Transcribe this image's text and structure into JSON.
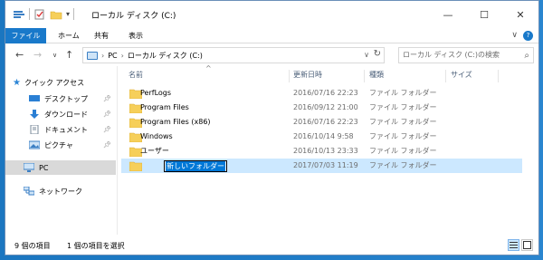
{
  "window": {
    "title": "ローカル ディスク (C:)",
    "controls": {
      "minimize": "—",
      "maximize": "☐",
      "close": "✕"
    }
  },
  "ribbon": {
    "tabs": [
      {
        "label": "ファイル",
        "active": true
      },
      {
        "label": "ホーム"
      },
      {
        "label": "共有"
      },
      {
        "label": "表示"
      }
    ],
    "expand": "∨",
    "help": "?"
  },
  "address_bar": {
    "segments": [
      "PC",
      "ローカル ディスク (C:)"
    ]
  },
  "search": {
    "placeholder": "ローカル ディスク (C:)の検索"
  },
  "navigation": {
    "quick_access": "クイック アクセス",
    "pinned": [
      {
        "label": "デスクトップ",
        "icon": "desktop-icon"
      },
      {
        "label": "ダウンロード",
        "icon": "download-icon"
      },
      {
        "label": "ドキュメント",
        "icon": "documents-icon"
      },
      {
        "label": "ピクチャ",
        "icon": "pictures-icon"
      }
    ],
    "pc": "PC",
    "network": "ネットワーク"
  },
  "columns": {
    "name": "名前",
    "modified": "更新日時",
    "type": "種類",
    "size": "サイズ"
  },
  "files": [
    {
      "name": "PerfLogs",
      "modified": "2016/07/16 22:23",
      "type": "ファイル フォルダー"
    },
    {
      "name": "Program Files",
      "modified": "2016/09/12 21:00",
      "type": "ファイル フォルダー"
    },
    {
      "name": "Program Files (x86)",
      "modified": "2016/07/16 22:23",
      "type": "ファイル フォルダー"
    },
    {
      "name": "Windows",
      "modified": "2016/10/14 9:58",
      "type": "ファイル フォルダー"
    },
    {
      "name": "ユーザー",
      "modified": "2016/10/13 23:33",
      "type": "ファイル フォルダー"
    },
    {
      "name": "新しいフォルダー",
      "modified": "2017/07/03 11:19",
      "type": "ファイル フォルダー",
      "renaming": true
    }
  ],
  "status": {
    "item_count": "9 個の項目",
    "selected": "1 個の項目を選択"
  },
  "colors": {
    "accent": "#1979ca",
    "selection": "#cce8ff",
    "folder": "#f6cf5a"
  }
}
